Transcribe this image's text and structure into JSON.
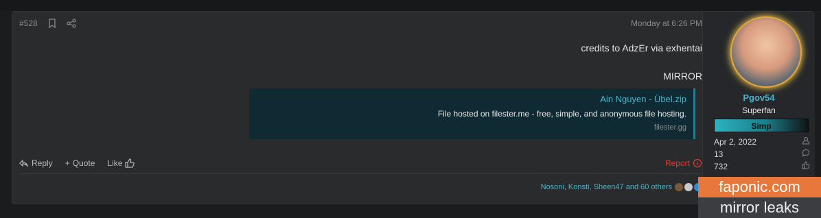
{
  "header": {
    "post_number": "#528",
    "timestamp": "Monday at 6:26 PM"
  },
  "body": {
    "line1": "credits to AdzEr via exhentai",
    "line2": "MIRROR"
  },
  "preview": {
    "title": "Ain Nguyen - Übel.zip",
    "description": "File hosted on filester.me - free, simple, and anonymous file hosting.",
    "domain": "filester.gg"
  },
  "actions": {
    "reply": "Reply",
    "quote": "Quote",
    "like": "Like",
    "report": "Report"
  },
  "reactions": {
    "text": "Nosoni, Konsti, Sheen47 and 60 others"
  },
  "user": {
    "name": "Pgov54",
    "title": "Superfan",
    "banner": "Simp",
    "joined": "Apr 2, 2022",
    "messages": "13",
    "reactions": "732"
  },
  "watermark": {
    "line1": "faponic.com",
    "line2": "mirror leaks"
  },
  "colors": {
    "accent": "#4bb3c7",
    "report": "#e03a30",
    "watermark_orange": "#e8773b"
  }
}
